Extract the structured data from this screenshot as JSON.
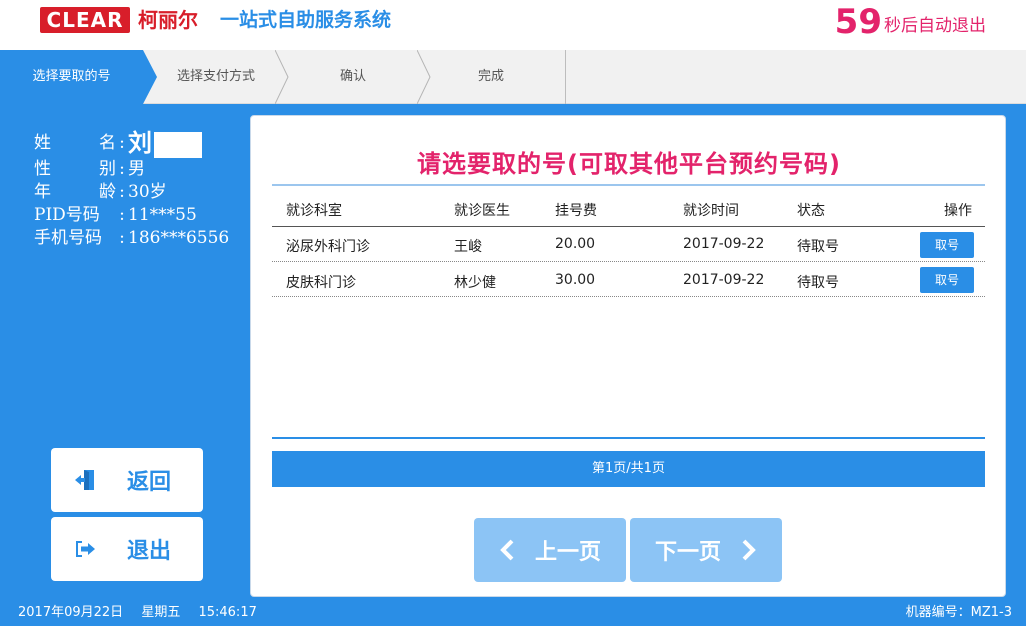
{
  "header": {
    "logo_text": "CLEAR",
    "logo_cn": "柯丽尔",
    "app_title": "一站式自助服务系统",
    "countdown_number": "59",
    "countdown_text": "秒后自动退出"
  },
  "steps": [
    {
      "label": "选择要取的号",
      "active": true
    },
    {
      "label": "选择支付方式",
      "active": false
    },
    {
      "label": "确认",
      "active": false
    },
    {
      "label": "完成",
      "active": false
    }
  ],
  "patient": {
    "name_label": "姓  名",
    "name_value": "刘",
    "gender_label": "性  别",
    "gender_value": "男",
    "age_label": "年  龄",
    "age_value": "30岁",
    "pid_label": "PID号码",
    "pid_value": "11***55",
    "phone_label": "手机号码",
    "phone_value": "186***6556",
    "colon": ":"
  },
  "side_buttons": {
    "back_label": "返回",
    "exit_label": "退出"
  },
  "main": {
    "title": "请选要取的号(可取其他平台预约号码)",
    "columns": [
      "就诊科室",
      "就诊医生",
      "挂号费",
      "就诊时间",
      "状态",
      "操作"
    ],
    "rows": [
      {
        "dept": "泌尿外科门诊",
        "doctor": "王峻",
        "fee": "20.00",
        "date": "2017-09-22",
        "status": "待取号",
        "action": "取号"
      },
      {
        "dept": "皮肤科门诊",
        "doctor": "林少健",
        "fee": "30.00",
        "date": "2017-09-22",
        "status": "待取号",
        "action": "取号"
      }
    ],
    "pager_text": "第1页/共1页",
    "prev_label": "上一页",
    "next_label": "下一页"
  },
  "footer": {
    "date": "2017年09月22日",
    "weekday": "星期五",
    "time": "15:46:17",
    "machine_label": "机器编号：MZ1-3"
  },
  "colors": {
    "primary_blue": "#2a8ee6",
    "accent_pink": "#e3236b",
    "brand_red": "#d81e2a",
    "disabled_blue": "#8cc4f5"
  }
}
